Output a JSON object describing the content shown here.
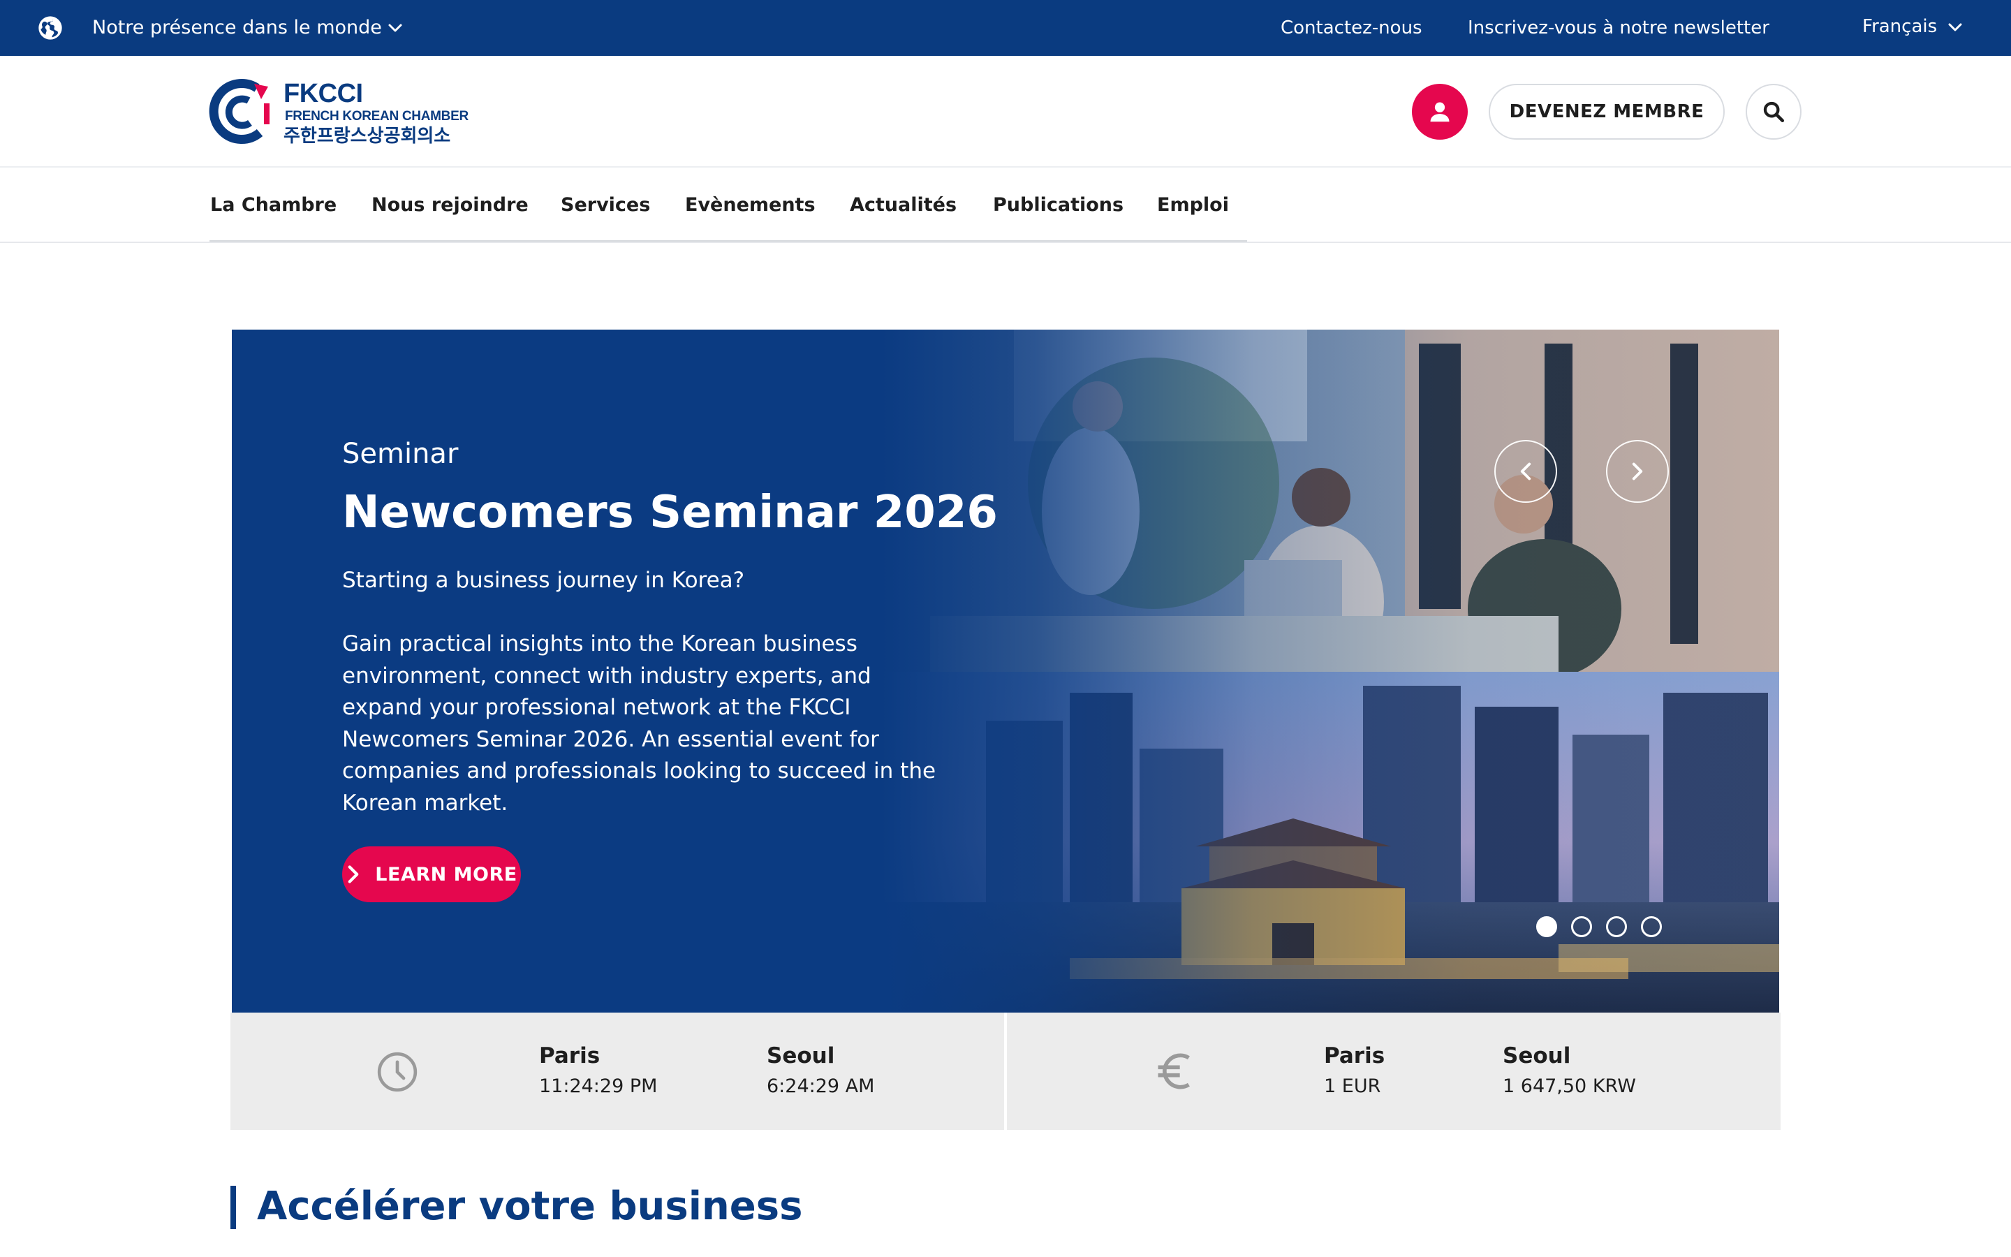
{
  "topbar": {
    "presence_label": "Notre présence dans le monde",
    "contact_label": "Contactez-nous",
    "newsletter_label": "Inscrivez-vous à notre newsletter",
    "language_label": "Français"
  },
  "header": {
    "logo": {
      "brand": "FKCCI",
      "subtitle": "FRENCH KOREAN CHAMBER",
      "korean": "주한프랑스상공회의소"
    },
    "member_button_label": "DEVENEZ MEMBRE"
  },
  "nav": {
    "items": [
      {
        "label": "La Chambre"
      },
      {
        "label": "Nous rejoindre"
      },
      {
        "label": "Services"
      },
      {
        "label": "Evènements"
      },
      {
        "label": "Actualités"
      },
      {
        "label": "Publications"
      },
      {
        "label": "Emploi"
      }
    ]
  },
  "hero": {
    "eyebrow": "Seminar",
    "title": "Newcomers Seminar 2026",
    "lead": "Starting a business journey in Korea?",
    "description": "Gain practical insights into the Korean business environment, connect with industry experts, and expand your professional network at the FKCCI Newcomers Seminar 2026. An essential event for companies and professionals looking to succeed in the Korean market.",
    "cta_label": "LEARN MORE",
    "slides_total": 4,
    "active_slide": 1
  },
  "info_strip": {
    "time": {
      "icon": "clock-icon",
      "cities": [
        {
          "city": "Paris",
          "value": "11:24:29 PM"
        },
        {
          "city": "Seoul",
          "value": "6:24:29 AM"
        }
      ]
    },
    "currency": {
      "icon": "euro-icon",
      "cities": [
        {
          "city": "Paris",
          "value": "1 EUR"
        },
        {
          "city": "Seoul",
          "value": "1 647,50 KRW"
        }
      ]
    }
  },
  "section": {
    "title": "Accélérer votre business"
  },
  "colors": {
    "brand_blue": "#0a3b80",
    "accent_pink": "#e5074e",
    "strip_gray": "#ececec"
  }
}
